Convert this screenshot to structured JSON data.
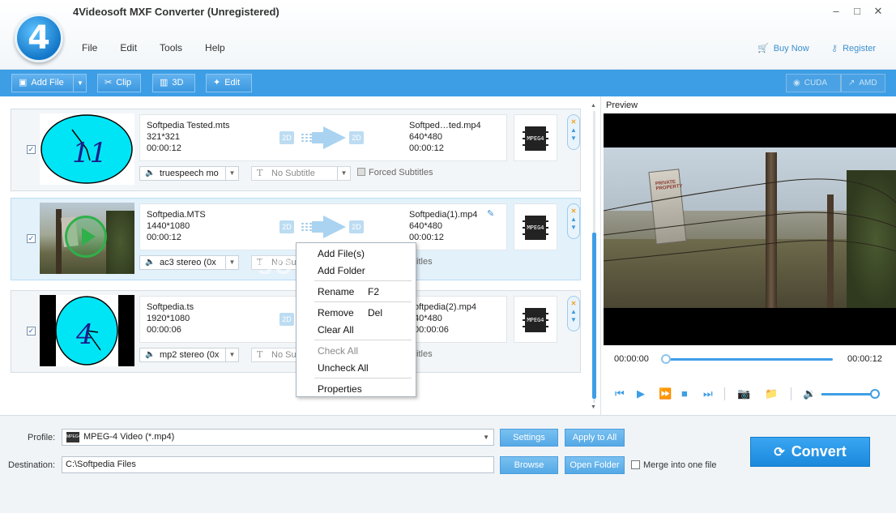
{
  "window": {
    "title": "4Videosoft MXF Converter (Unregistered)",
    "logo_text": "4",
    "minimize": "–",
    "maximize": "□",
    "close": "✕"
  },
  "menu": [
    "File",
    "Edit",
    "Tools",
    "Help"
  ],
  "header_links": {
    "buy": "Buy Now",
    "register": "Register"
  },
  "toolbar": {
    "add_file": "Add File",
    "clip": "Clip",
    "three_d": "3D",
    "edit": "Edit",
    "cuda": "CUDA",
    "amd": "AMD"
  },
  "files": [
    {
      "checked": true,
      "src_name": "Softpedia Tested.mts",
      "src_res": "321*321",
      "src_dur": "00:00:12",
      "dst_name": "Softped…ted.mp4",
      "dst_res": "640*480",
      "dst_dur": "00:00:12",
      "audio": "truespeech mo",
      "subtitle": "No Subtitle",
      "forced": "Forced Subtitles",
      "thumb_text": "11"
    },
    {
      "checked": true,
      "src_name": "Softpedia.MTS",
      "src_res": "1440*1080",
      "src_dur": "00:00:12",
      "dst_name": "Softpedia(1).mp4",
      "dst_res": "640*480",
      "dst_dur": "00:00:12",
      "audio": "ac3 stereo (0x",
      "subtitle": "No Subti",
      "forced": "titles"
    },
    {
      "checked": true,
      "src_name": "Softpedia.ts",
      "src_res": "1920*1080",
      "src_dur": "00:00:06",
      "dst_name": "oftpedia(2).mp4",
      "dst_res": "40*480",
      "dst_dur": "00:00:06",
      "audio": "mp2 stereo (0x",
      "subtitle": "No Subti",
      "forced": "titles",
      "thumb_text": "4"
    }
  ],
  "badge_2d": "2D",
  "format_label": "MPEG4",
  "preview": {
    "label": "Preview",
    "time_current": "00:00:00",
    "time_total": "00:00:12",
    "sign_text": "PRIVATE PROPERTY",
    "seek_progress": 0
  },
  "context_menu": {
    "items": [
      {
        "label": "Add File(s)",
        "key": "",
        "disabled": false
      },
      {
        "label": "Add Folder",
        "key": "",
        "disabled": false
      },
      {
        "label": "Rename",
        "key": "F2",
        "disabled": false
      },
      {
        "label": "Remove",
        "key": "Del",
        "disabled": false
      },
      {
        "label": "Clear All",
        "key": "",
        "disabled": false
      },
      {
        "label": "Check All",
        "key": "",
        "disabled": true
      },
      {
        "label": "Uncheck All",
        "key": "",
        "disabled": false
      },
      {
        "label": "Properties",
        "key": "",
        "disabled": false
      }
    ]
  },
  "watermark": "SOFTPEDIA",
  "bottom": {
    "profile_label": "Profile:",
    "profile_value": "MPEG-4 Video (*.mp4)",
    "profile_icon": "MPEG4",
    "settings": "Settings",
    "apply_all": "Apply to All",
    "dest_label": "Destination:",
    "dest_value": "C:\\Softpedia Files",
    "browse": "Browse",
    "open_folder": "Open Folder",
    "merge": "Merge into one file",
    "convert": "Convert"
  },
  "colors": {
    "accent": "#3d9ee6",
    "toolbar": "#3d9ee6",
    "convert": "#1b88dc",
    "clock_face": "#00e5f5"
  }
}
